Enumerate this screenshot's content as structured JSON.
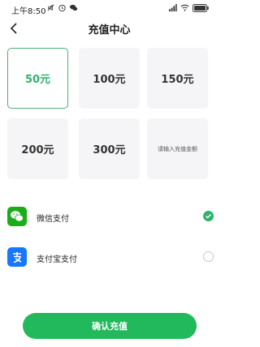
{
  "status_bar": {
    "time": "上午8:50",
    "left_icons": [
      "mute-icon",
      "alarm-icon",
      "wechat-notification-icon"
    ],
    "right_icons": [
      "signal-icon",
      "wifi-icon",
      "battery-icon"
    ]
  },
  "header": {
    "title": "充值中心",
    "back_icon": "chevron-left-icon"
  },
  "amounts": [
    {
      "label": "50元",
      "selected": true
    },
    {
      "label": "100元",
      "selected": false
    },
    {
      "label": "150元",
      "selected": false
    },
    {
      "label": "200元",
      "selected": false
    },
    {
      "label": "300元",
      "selected": false
    }
  ],
  "custom_amount": {
    "placeholder": "请输入充值金额"
  },
  "payment_methods": [
    {
      "label": "微信支付",
      "icon": "wechat-pay-icon",
      "selected": true,
      "color": "#1aad19"
    },
    {
      "label": "支付宝支付",
      "icon": "alipay-icon",
      "selected": false,
      "color": "#1677ff"
    }
  ],
  "confirm": {
    "label": "确认充值"
  },
  "colors": {
    "accent": "#22b85c",
    "selected_text": "#2fb36b",
    "tile_bg": "#f5f5f7"
  }
}
